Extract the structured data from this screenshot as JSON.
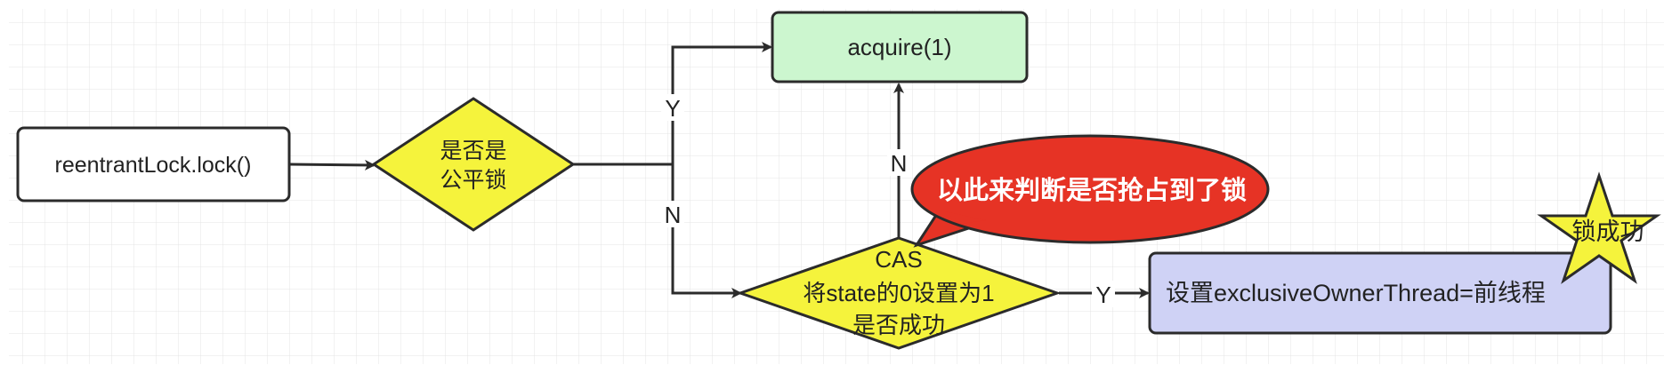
{
  "colors": {
    "grid_line": "#e4e4e4",
    "stroke": "#2b2b2b",
    "start_fill": "#ffffff",
    "decision_fill": "#f5f33c",
    "acquire_fill": "#ccf6cf",
    "set_owner_fill": "#cfd2f5",
    "callout_fill": "#e63325",
    "star_fill": "#f5f33c"
  },
  "nodes": {
    "start": {
      "label": "reentrantLock.lock()"
    },
    "fair_check": {
      "line1": "是否是",
      "line2": "公平锁"
    },
    "acquire": {
      "label": "acquire(1)"
    },
    "cas_check": {
      "line1": "CAS",
      "line2": "将state的0设置为1",
      "line3": "是否成功"
    },
    "set_owner": {
      "label": "设置exclusiveOwnerThread=前线程"
    },
    "callout": {
      "label": "以此来判断是否抢占到了锁"
    },
    "success_star": {
      "label": "锁成功"
    }
  },
  "edges": {
    "fair_yes": {
      "label": "Y"
    },
    "fair_no": {
      "label": "N"
    },
    "cas_no": {
      "label": "N"
    },
    "cas_yes": {
      "label": "Y"
    }
  }
}
